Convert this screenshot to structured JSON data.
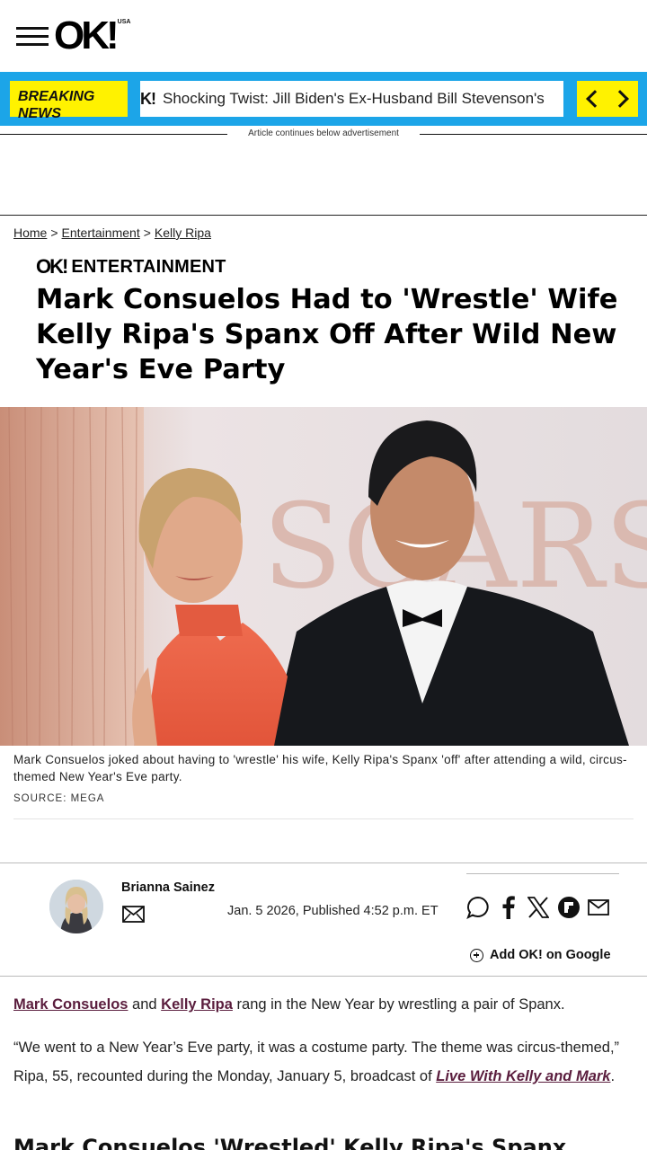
{
  "header": {
    "logo": "OK!",
    "logo_region": "USA"
  },
  "breaking": {
    "label_line1": "BREAKING",
    "label_line2": "NEWS",
    "story_mark": "K!",
    "story_text": "Shocking Twist: Jill Biden's Ex-Husband Bill Stevenson's"
  },
  "ad_notice": "Article continues below advertisement",
  "breadcrumb": {
    "items": [
      "Home",
      "Entertainment",
      "Kelly Ripa"
    ],
    "separator": ">"
  },
  "category": {
    "logo": "OK!",
    "label": "ENTERTAINMENT"
  },
  "article": {
    "headline": "Mark Consuelos Had to 'Wrestle' Wife Kelly Ripa's Spanx Off After Wild New Year's Eve Party",
    "image_text": "SCARS",
    "caption": "Mark Consuelos joked about having to 'wrestle' his wife, Kelly Ripa's Spanx 'off' after attending a wild, circus-themed New Year's Eve party.",
    "source": "SOURCE: MEGA"
  },
  "author": {
    "name": "Brianna Sainez",
    "published": "Jan. 5 2026, Published 4:52 p.m. ET"
  },
  "share": {
    "icons": [
      "comment-icon",
      "facebook-icon",
      "x-icon",
      "flipboard-icon",
      "email-icon"
    ]
  },
  "add_google": "Add OK! on Google",
  "body": {
    "p1_link1": "Mark Consuelos",
    "p1_mid": " and ",
    "p1_link2": "Kelly Ripa",
    "p1_rest": " rang in the New Year by wrestling a pair of Spanx.",
    "p2_text": "“We went to a New Year’s Eve party, it was a costume party. The theme was circus-themed,” Ripa, 55, recounted during the Monday, January 5, broadcast of ",
    "p2_link": "Live With Kelly and Mark",
    "p2_end": ".",
    "subhead": "Mark Consuelos 'Wrestled' Kelly Ripa's Spanx"
  },
  "colors": {
    "breaking_bar": "#1ca5e8",
    "breaking_yellow": "#fff200",
    "link": "#5a1d3d"
  }
}
